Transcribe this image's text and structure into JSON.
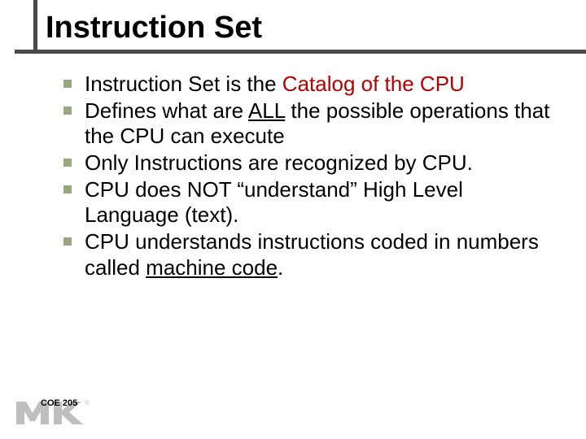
{
  "title": "Instruction Set",
  "bullets": [
    {
      "pre": "Instruction Set is the ",
      "hl": "Catalog of the CPU",
      "post": ""
    },
    {
      "pre": "Defines what are ",
      "u": "ALL",
      "post": " the possible operations that the CPU can execute"
    },
    {
      "pre": "Only Instructions are recognized by CPU."
    },
    {
      "pre": "CPU does NOT “understand” High Level Language (text)."
    },
    {
      "pre": "CPU understands instructions coded in numbers called ",
      "u": "machine code",
      "post": "."
    }
  ],
  "footer": {
    "course": "COE 205"
  }
}
